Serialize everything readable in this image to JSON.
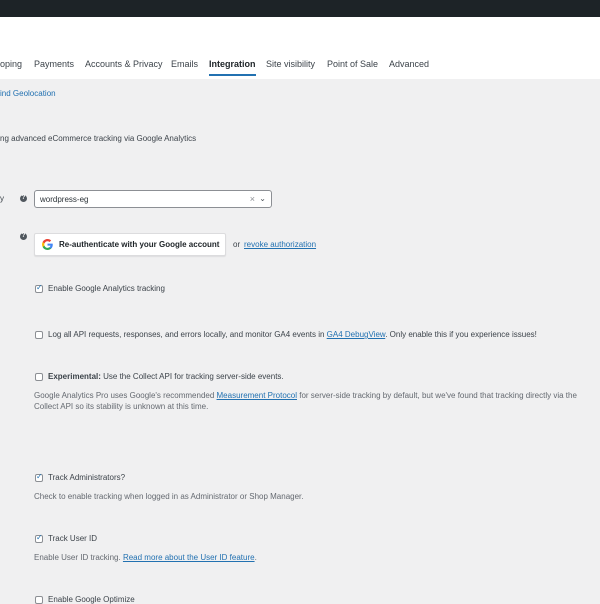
{
  "tabs": [
    {
      "label": "oping"
    },
    {
      "label": "Payments"
    },
    {
      "label": "Accounts & Privacy"
    },
    {
      "label": "Emails"
    },
    {
      "label": "Integration",
      "active": true
    },
    {
      "label": "Site visibility"
    },
    {
      "label": "Point of Sale"
    },
    {
      "label": "Advanced"
    }
  ],
  "subsection_link": "ind Geolocation",
  "intro_text": "ng advanced eCommerce tracking via Google Analytics",
  "field_label_fragment": "y",
  "property_select": {
    "value": "wordpress-eg",
    "clear_symbol": "×",
    "chevron": "⌄"
  },
  "auth": {
    "button_label": "Re-authenticate with your Google account",
    "or_text": "or",
    "revoke_link": "revoke authorization"
  },
  "options": {
    "enable_tracking": {
      "label": "Enable Google Analytics tracking",
      "checked": true
    },
    "log_requests": {
      "checked": false,
      "text_before": "Log all API requests, responses, and errors locally, and monitor GA4 events in ",
      "link": "GA4 DebugView",
      "text_after": ". Only enable this if you experience issues!"
    },
    "experimental": {
      "checked": false,
      "bold": "Experimental:",
      "label": " Use the Collect API for tracking server-side events.",
      "desc_before": "Google Analytics Pro uses Google's recommended ",
      "desc_link": "Measurement Protocol",
      "desc_after": " for server-side tracking by default, but we've found that tracking directly via the",
      "desc_line2": "Collect API so its stability is unknown at this time."
    },
    "track_admins": {
      "label": "Track Administrators?",
      "checked": true,
      "desc": "Check to enable tracking when logged in as Administrator or Shop Manager."
    },
    "track_user_id": {
      "label": "Track User ID",
      "checked": true,
      "desc_before": "Enable User ID tracking. ",
      "desc_link": "Read more about the User ID feature",
      "desc_after": "."
    },
    "enable_optimize": {
      "label": "Enable Google Optimize",
      "checked": false
    }
  },
  "icons": {
    "help": "help-icon",
    "google": "google-g-icon",
    "check": "checkmark-icon"
  },
  "colors": {
    "accent": "#2271b1",
    "topbar": "#1d2327",
    "background": "#f0f0f1"
  }
}
